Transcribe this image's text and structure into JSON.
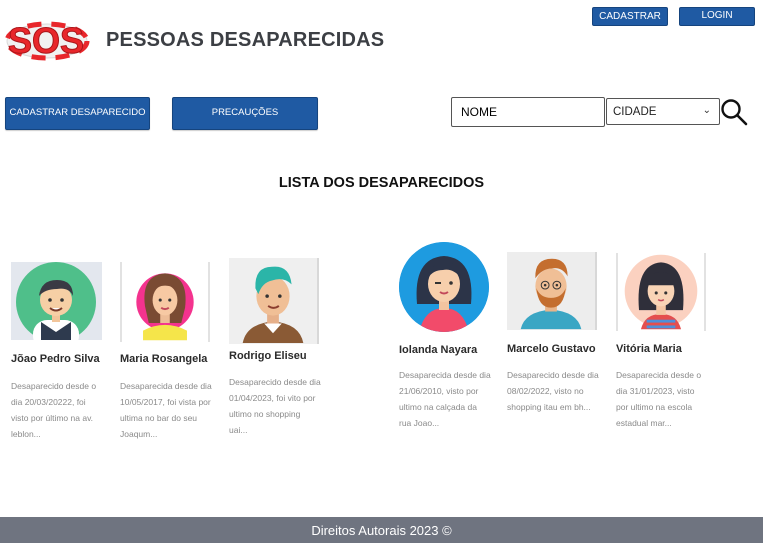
{
  "header": {
    "logo_text": "SOS",
    "title": "PESSOAS DESAPARECIDAS",
    "cadastrar_label": "CADASTRAR",
    "login_label": "LOGIN"
  },
  "nav": {
    "cadastrar_desaparecido_label": "CADASTRAR DESAPARECIDO",
    "precaucoes_label": "PRECAUÇÕES"
  },
  "search": {
    "name_value": "NOME",
    "city_value": "CIDADE",
    "icon": "search-icon"
  },
  "list_title": "LISTA DOS DESAPARECIDOS",
  "people": [
    {
      "name": "Jõao Pedro Silva",
      "desc": "Desaparecido desde o dia 20/03/20222, foi visto por último na av. leblon..."
    },
    {
      "name": "Maria Rosangela",
      "desc": "Desaparecida desde dia 10/05/2017, foi vista por ultima no bar do seu Joaqum..."
    },
    {
      "name": "Rodrigo Eliseu",
      "desc": "Desaparecido desde dia 01/04/2023, foi vito por ultimo no shopping uai..."
    },
    {
      "name": "Iolanda Nayara",
      "desc": "Desaparecida desde dia 21/06/2010, visto por ultimo na calçada da rua Joao..."
    },
    {
      "name": "Marcelo Gustavo",
      "desc": "Desaparecido desde dia 08/02/2022, visto no shopping itau em bh..."
    },
    {
      "name": "Vitória Maria",
      "desc": "Desaparecida desde o dia 31/01/2023, visto por ultimo na escola estadual mar..."
    }
  ],
  "footer": {
    "text": "Direitos Autorais 2023 ©"
  },
  "colors": {
    "primary_button": "#1f5aa3",
    "footer_bg": "#6f7480",
    "logo_red": "#e8262b"
  }
}
